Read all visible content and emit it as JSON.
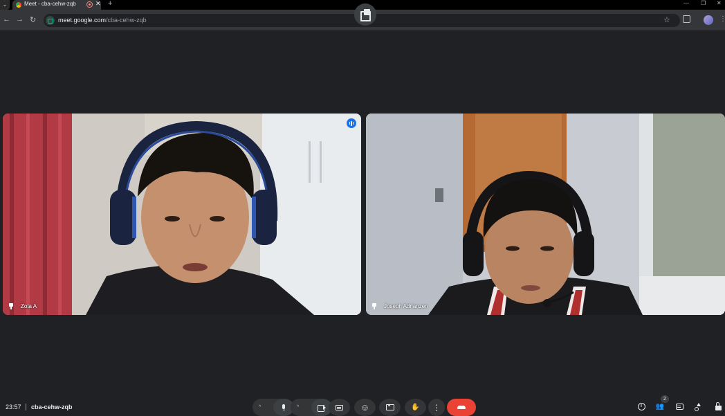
{
  "browser": {
    "tab_title": "Meet - cba-cehw-zqb",
    "new_tab_symbol": "+",
    "close_symbol": "✕",
    "url_host": "meet.google.com",
    "url_path": "/cba-cehw-zqb",
    "back_symbol": "←",
    "forward_symbol": "→",
    "reload_symbol": "↻",
    "star_symbol": "☆",
    "menu_symbol": "⋮",
    "minimize_symbol": "—",
    "restore_symbol": "❐",
    "win_close_symbol": "✕"
  },
  "participants": [
    {
      "name": "Zota A",
      "speaking": true
    },
    {
      "name": "Joseph Adrianzen",
      "speaking": false
    }
  ],
  "bottom_bar": {
    "time": "23:57",
    "meeting_code": "cba-cehw-zqb",
    "caret_symbol": "^",
    "people_count": "2",
    "info_symbol": "i",
    "emoji_symbol": "☺",
    "raise_hand_symbol": "✋",
    "more_symbol": "⋮",
    "people_symbol": "👥"
  },
  "colors": {
    "end_call": "#ea4335",
    "speaking_indicator": "#1a73e8",
    "background": "#202124"
  }
}
